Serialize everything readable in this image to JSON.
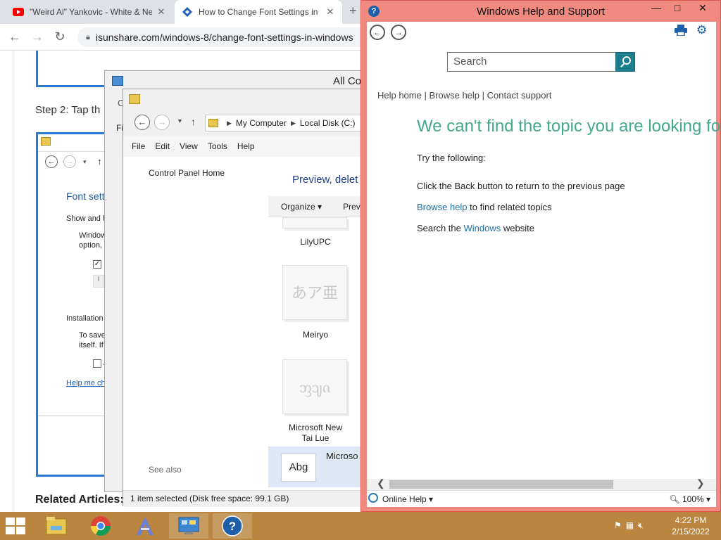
{
  "browser": {
    "tabs": [
      {
        "title": "\"Weird Al\" Yankovic - White & Ne",
        "icon": "youtube-icon"
      },
      {
        "title": "How to Change Font Settings in",
        "icon": "isunshare-icon"
      }
    ],
    "url": "isunshare.com/windows-8/change-font-settings-in-windows",
    "article": {
      "step_text": "Step 2: Tap th",
      "related": "Related Articles:",
      "inner": {
        "title": "Font sett",
        "show_label": "Show and h",
        "wrap1": "Window",
        "wrap2": "option,",
        "check_char": "✓",
        "check_label": "I",
        "btn_char": "I",
        "install_label": "Installation",
        "save1": "To save",
        "save2": "itself. If",
        "check2_label": "A",
        "help_link": "Help me ch"
      }
    }
  },
  "control_panel": {
    "title": "All Co",
    "side_label": "Fi",
    "back_glyph": "C"
  },
  "explorer": {
    "breadcrumb": [
      "My Computer",
      "Local Disk (C:)"
    ],
    "menu": [
      "File",
      "Edit",
      "View",
      "Tools",
      "Help"
    ],
    "left_link": "Control Panel Home",
    "see_also": "See also",
    "header": "Preview, delet",
    "toolbar": {
      "organize": "Organize",
      "preview": "Prev"
    },
    "fonts": [
      {
        "name": "LilyUPC",
        "sample": ""
      },
      {
        "name": "Meiryo",
        "sample": "あア亜"
      },
      {
        "name": "Microsoft New Tai Lue",
        "sample": "ᦀᦻᦵ"
      }
    ],
    "selected": {
      "sample": "Abg",
      "name": "Microso"
    },
    "status": "1 item selected (Disk free space: 99.1 GB)"
  },
  "help": {
    "title": "Windows Help and Support",
    "search_placeholder": "Search",
    "links": [
      "Help home",
      "Browse help",
      "Contact support"
    ],
    "heading": "We can't find the topic you are looking for",
    "try": "Try the following:",
    "item1": "Click the Back button to return to the previous page",
    "item2_link": "Browse help",
    "item2_rest": " to find related topics",
    "item3_pre": "Search the ",
    "item3_link": "Windows",
    "item3_post": " website",
    "online_help": "Online Help",
    "zoom": "100%"
  },
  "taskbar": {
    "apps": [
      "file-explorer-icon",
      "chrome-icon",
      "font-app-icon",
      "control-panel-icon",
      "help-icon"
    ],
    "time": "4:22 PM",
    "date": "2/15/2022"
  },
  "colors": {
    "taskbar": "#b9853f",
    "help_frame": "#f08a80",
    "heading": "#44a88e",
    "link": "#1c6ea4"
  }
}
